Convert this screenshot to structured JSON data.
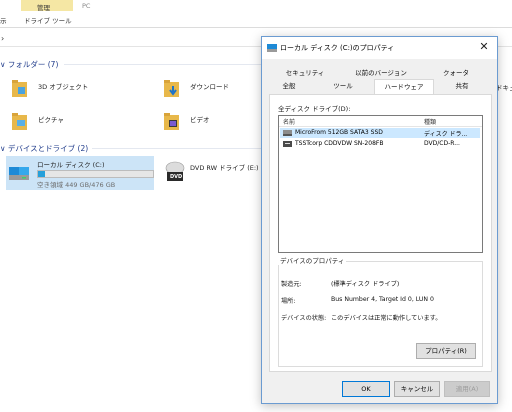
{
  "explorer": {
    "ribbon": {
      "manage_tab": "管理",
      "pc_tab": "PC",
      "left_cut": "示",
      "drive_tools": "ドライブ ツール"
    },
    "address_arrow": "›",
    "right_cut_label": "ドキュ",
    "folders_header": "∨ フォルダー (7)",
    "folders": [
      {
        "label": "3D オブジェクト"
      },
      {
        "label": "ダウンロード"
      },
      {
        "label": "ピクチャ"
      },
      {
        "label": "ビデオ"
      }
    ],
    "devices_header": "∨ デバイスとドライブ (2)",
    "local_disk": {
      "name": "ローカル ディスク (C:)",
      "free_text": "空き領域 449 GB/476 GB",
      "used_fraction": 0.06
    },
    "dvd_drive": {
      "name": "DVD RW ドライブ (E:)",
      "badge": "DVD"
    }
  },
  "dialog": {
    "title": "ローカル ディスク (C:)のプロパティ",
    "close_glyph": "✕",
    "tabs_row1": [
      "セキュリティ",
      "以前のバージョン",
      "クォータ"
    ],
    "tabs_row2": [
      "全般",
      "ツール",
      "ハードウェア",
      "共有"
    ],
    "all_drives_label": "全ディスク ドライブ(D):",
    "columns": {
      "name": "名前",
      "type": "種類"
    },
    "drives": [
      {
        "name": "MicroFrom 512GB SATA3 SSD",
        "type": "ディスク ドラ..."
      },
      {
        "name": "TSSTcorp CDDVDW SN-208FB",
        "type": "DVD/CD-R..."
      }
    ],
    "device_props": {
      "title": "デバイスのプロパティ",
      "manufacturer_label": "製造元:",
      "manufacturer_value": "(標準ディスク ドライブ)",
      "location_label": "場所:",
      "location_value": "Bus Number 4, Target Id 0, LUN 0",
      "status_label": "デバイスの状態:",
      "status_value": "このデバイスは正常に動作しています。",
      "properties_button": "プロパティ(R)"
    },
    "buttons": {
      "ok": "OK",
      "cancel": "キャンセル",
      "apply": "適用(A)"
    }
  },
  "colors": {
    "accent": "#0078d7",
    "selection": "#cce8ff",
    "folder": "#e8b84a",
    "group_header": "#1e3a8a"
  }
}
